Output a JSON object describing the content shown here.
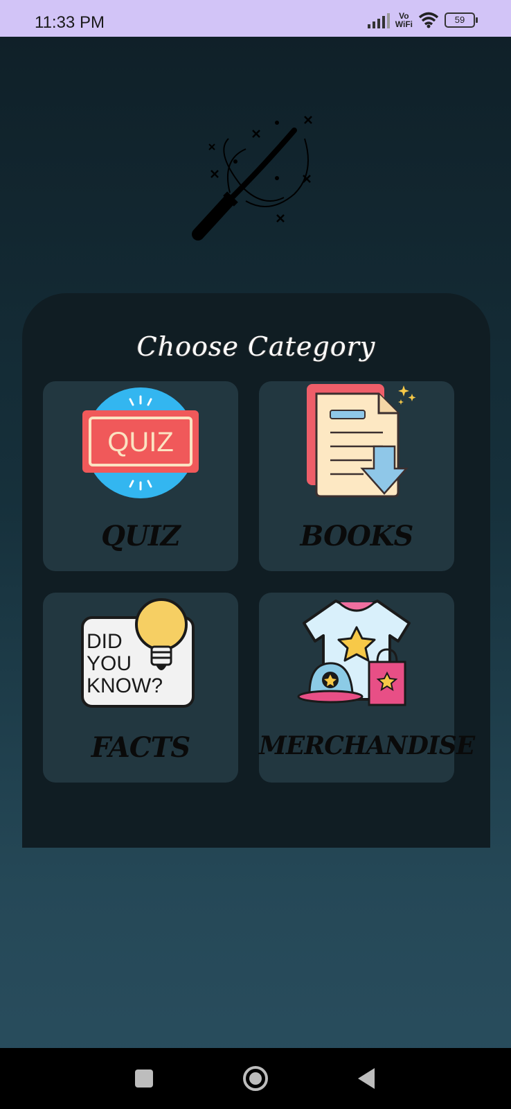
{
  "status_bar": {
    "time": "11:33 PM",
    "network_label_top": "Vo",
    "network_label_bottom": "WiFi",
    "battery": "59"
  },
  "header_icon": "magic-wand-icon",
  "panel": {
    "title": "Choose Category"
  },
  "categories": [
    {
      "label": "QUIZ",
      "icon": "quiz-icon"
    },
    {
      "label": "BOOKS",
      "icon": "books-icon"
    },
    {
      "label": "FACTS",
      "icon": "did-you-know-icon"
    },
    {
      "label": "MERCHANDISE",
      "icon": "merchandise-icon"
    }
  ],
  "icons": {
    "quiz_text": "QUIZ",
    "facts_line1": "DID",
    "facts_line2": "YOU",
    "facts_line3": "KNOW?"
  },
  "nav_bar": [
    "recents-button",
    "home-button",
    "back-button"
  ],
  "colors": {
    "status_bar": "#d2c4f7",
    "panel": "#101d23",
    "card": "#223740",
    "quiz_red": "#f0595a",
    "quiz_blue": "#33b6f0"
  }
}
